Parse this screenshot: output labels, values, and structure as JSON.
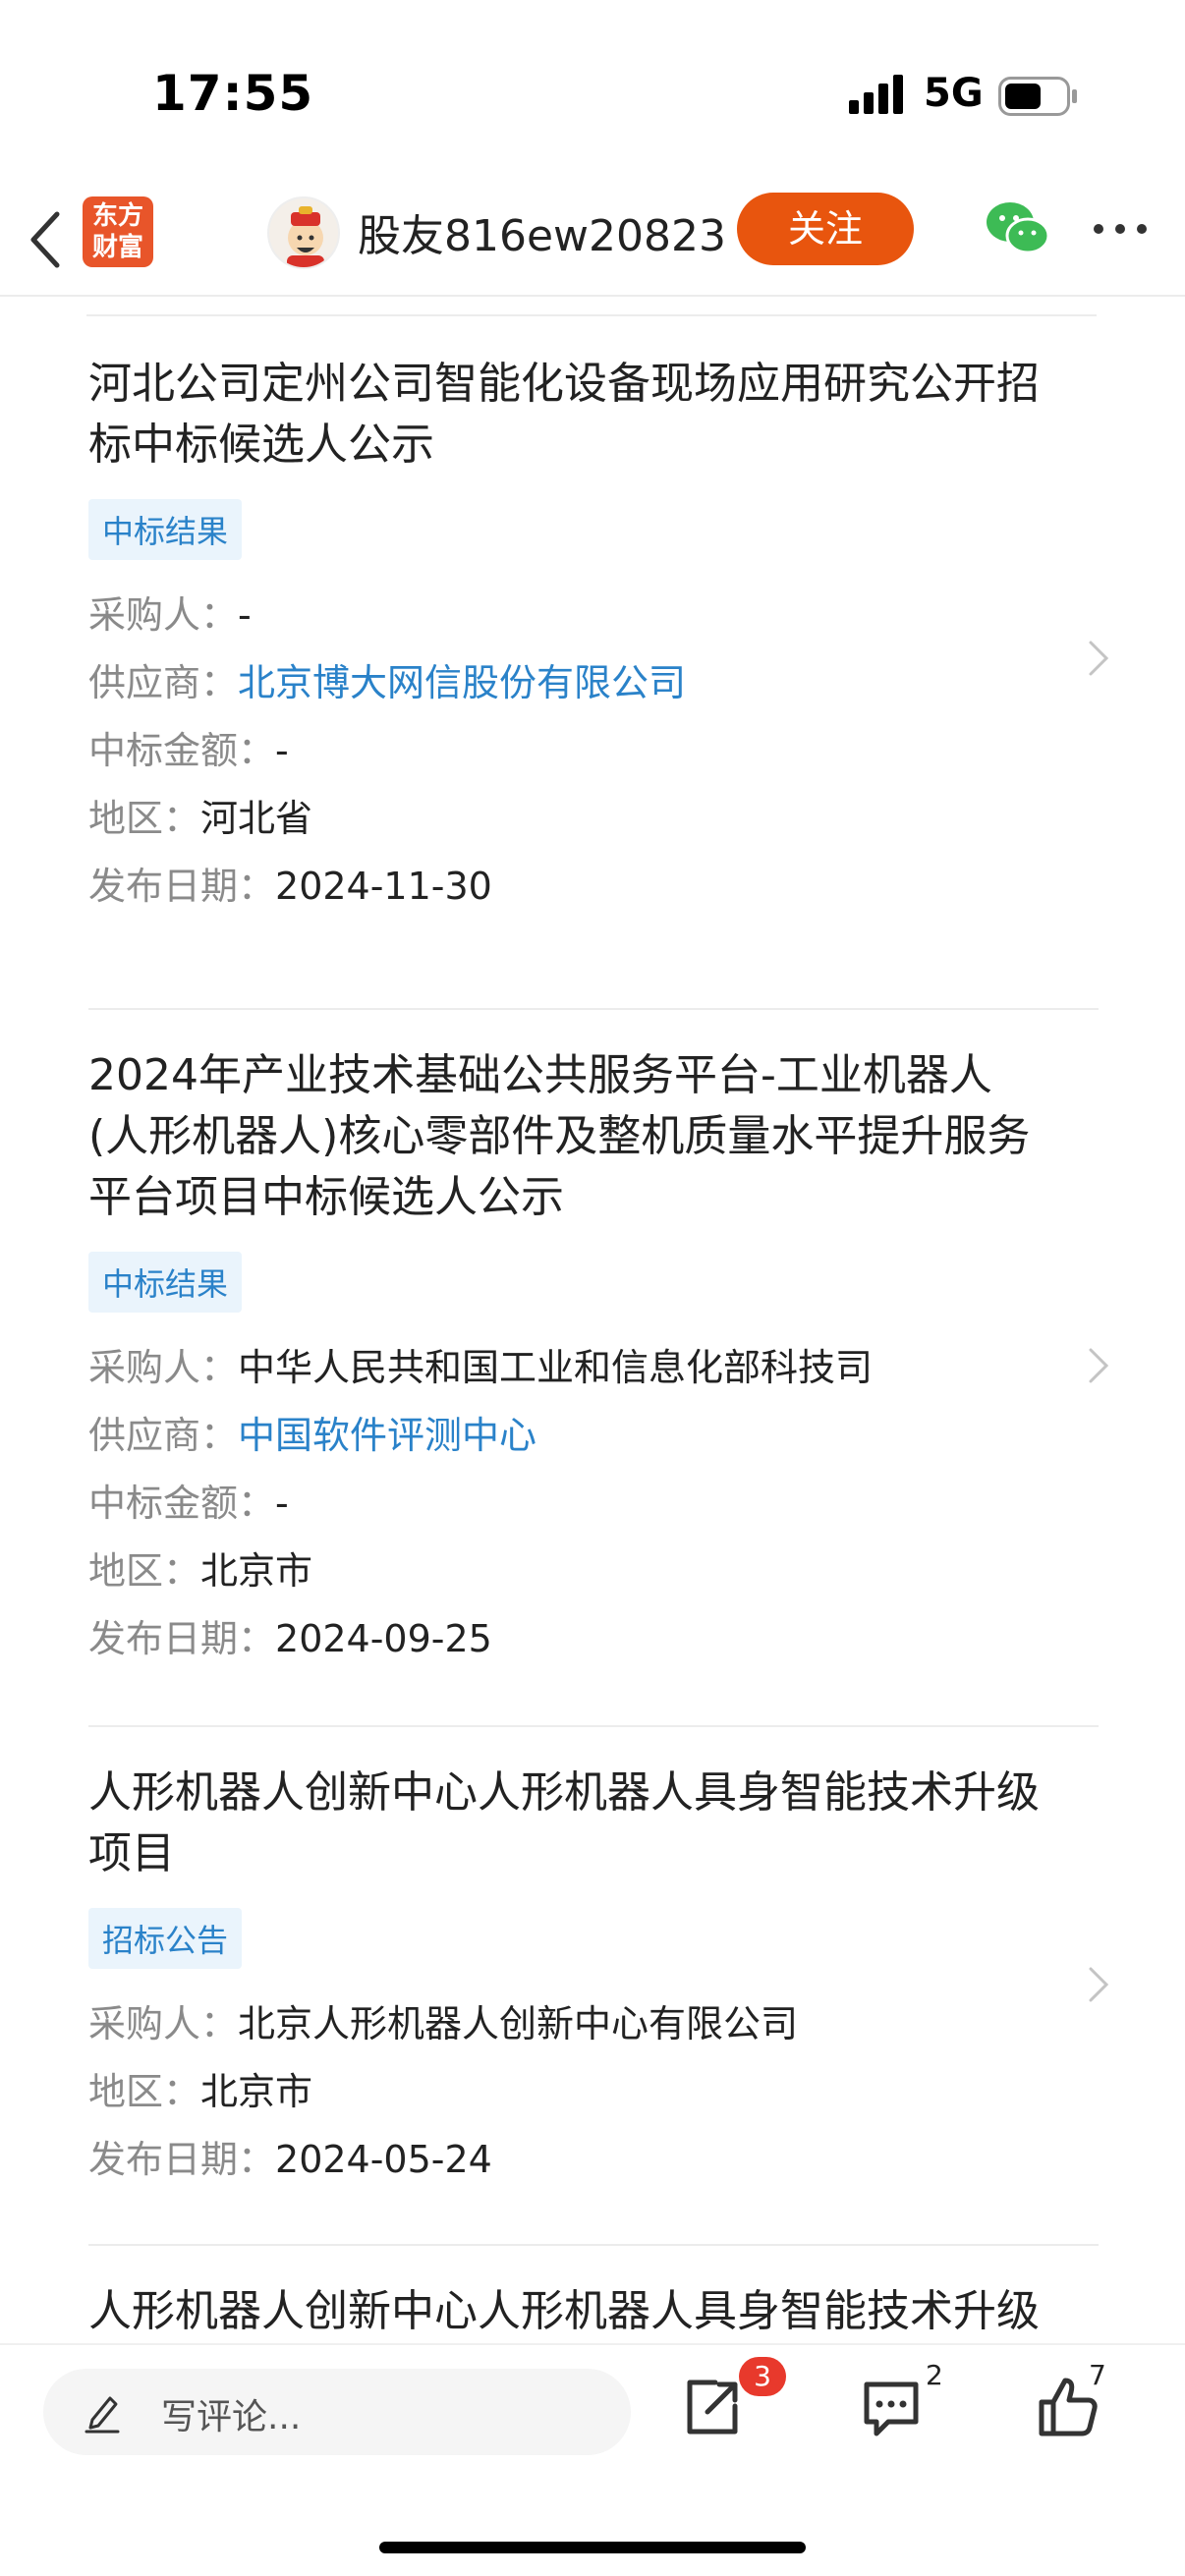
{
  "status": {
    "time": "17:55",
    "network": "5G"
  },
  "nav": {
    "logo_line1": "东方",
    "logo_line2": "财富",
    "author": "股友816ew20823",
    "follow_label": "关注"
  },
  "cards": [
    {
      "title": "河北公司定州公司智能化设备现场应用研究公开招标中标候选人公示",
      "tag": "中标结果",
      "fields": [
        {
          "label": "采购人：",
          "value": "-"
        },
        {
          "label": "供应商：",
          "value": "北京博大网信股份有限公司"
        },
        {
          "label": "中标金额：",
          "value": "-"
        },
        {
          "label": "地区：",
          "value": "河北省"
        },
        {
          "label": "发布日期：",
          "value": "2024-11-30"
        }
      ]
    },
    {
      "title": "2024年产业技术基础公共服务平台-工业机器人(人形机器人)核心零部件及整机质量水平提升服务平台项目中标候选人公示",
      "tag": "中标结果",
      "fields": [
        {
          "label": "采购人：",
          "value": "中华人民共和国工业和信息化部科技司"
        },
        {
          "label": "供应商：",
          "value": "中国软件评测中心"
        },
        {
          "label": "中标金额：",
          "value": "-"
        },
        {
          "label": "地区：",
          "value": "北京市"
        },
        {
          "label": "发布日期：",
          "value": "2024-09-25"
        }
      ]
    },
    {
      "title": "人形机器人创新中心人形机器人具身智能技术升级项目",
      "tag": "招标公告",
      "fields": [
        {
          "label": "采购人：",
          "value": "北京人形机器人创新中心有限公司"
        },
        {
          "label": "地区：",
          "value": "北京市"
        },
        {
          "label": "发布日期：",
          "value": "2024-05-24"
        }
      ]
    },
    {
      "title": "人形机器人创新中心人形机器人具身智能技术升级项目"
    }
  ],
  "bottom": {
    "comment_placeholder": "写评论...",
    "share_badge": "3",
    "comment_count": "2",
    "like_count": "7"
  }
}
